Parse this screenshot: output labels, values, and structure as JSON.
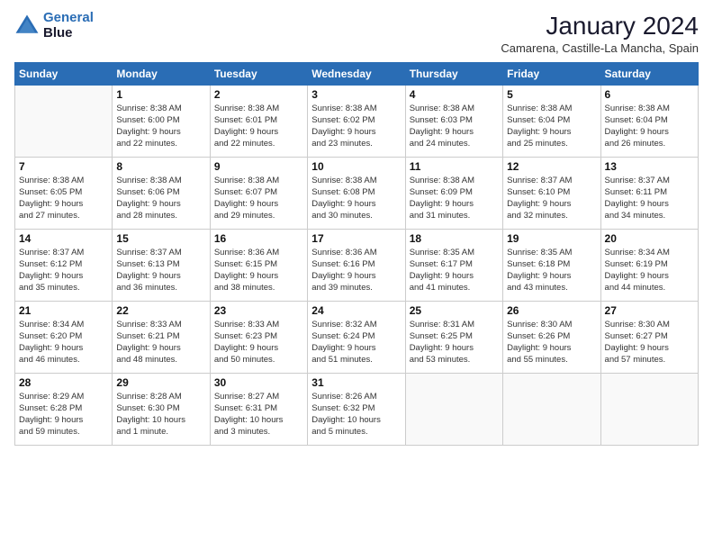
{
  "logo": {
    "line1": "General",
    "line2": "Blue"
  },
  "title": "January 2024",
  "subtitle": "Camarena, Castille-La Mancha, Spain",
  "days_of_week": [
    "Sunday",
    "Monday",
    "Tuesday",
    "Wednesday",
    "Thursday",
    "Friday",
    "Saturday"
  ],
  "weeks": [
    [
      {
        "day": "",
        "info": ""
      },
      {
        "day": "1",
        "info": "Sunrise: 8:38 AM\nSunset: 6:00 PM\nDaylight: 9 hours\nand 22 minutes."
      },
      {
        "day": "2",
        "info": "Sunrise: 8:38 AM\nSunset: 6:01 PM\nDaylight: 9 hours\nand 22 minutes."
      },
      {
        "day": "3",
        "info": "Sunrise: 8:38 AM\nSunset: 6:02 PM\nDaylight: 9 hours\nand 23 minutes."
      },
      {
        "day": "4",
        "info": "Sunrise: 8:38 AM\nSunset: 6:03 PM\nDaylight: 9 hours\nand 24 minutes."
      },
      {
        "day": "5",
        "info": "Sunrise: 8:38 AM\nSunset: 6:04 PM\nDaylight: 9 hours\nand 25 minutes."
      },
      {
        "day": "6",
        "info": "Sunrise: 8:38 AM\nSunset: 6:04 PM\nDaylight: 9 hours\nand 26 minutes."
      }
    ],
    [
      {
        "day": "7",
        "info": "Sunrise: 8:38 AM\nSunset: 6:05 PM\nDaylight: 9 hours\nand 27 minutes."
      },
      {
        "day": "8",
        "info": "Sunrise: 8:38 AM\nSunset: 6:06 PM\nDaylight: 9 hours\nand 28 minutes."
      },
      {
        "day": "9",
        "info": "Sunrise: 8:38 AM\nSunset: 6:07 PM\nDaylight: 9 hours\nand 29 minutes."
      },
      {
        "day": "10",
        "info": "Sunrise: 8:38 AM\nSunset: 6:08 PM\nDaylight: 9 hours\nand 30 minutes."
      },
      {
        "day": "11",
        "info": "Sunrise: 8:38 AM\nSunset: 6:09 PM\nDaylight: 9 hours\nand 31 minutes."
      },
      {
        "day": "12",
        "info": "Sunrise: 8:37 AM\nSunset: 6:10 PM\nDaylight: 9 hours\nand 32 minutes."
      },
      {
        "day": "13",
        "info": "Sunrise: 8:37 AM\nSunset: 6:11 PM\nDaylight: 9 hours\nand 34 minutes."
      }
    ],
    [
      {
        "day": "14",
        "info": "Sunrise: 8:37 AM\nSunset: 6:12 PM\nDaylight: 9 hours\nand 35 minutes."
      },
      {
        "day": "15",
        "info": "Sunrise: 8:37 AM\nSunset: 6:13 PM\nDaylight: 9 hours\nand 36 minutes."
      },
      {
        "day": "16",
        "info": "Sunrise: 8:36 AM\nSunset: 6:15 PM\nDaylight: 9 hours\nand 38 minutes."
      },
      {
        "day": "17",
        "info": "Sunrise: 8:36 AM\nSunset: 6:16 PM\nDaylight: 9 hours\nand 39 minutes."
      },
      {
        "day": "18",
        "info": "Sunrise: 8:35 AM\nSunset: 6:17 PM\nDaylight: 9 hours\nand 41 minutes."
      },
      {
        "day": "19",
        "info": "Sunrise: 8:35 AM\nSunset: 6:18 PM\nDaylight: 9 hours\nand 43 minutes."
      },
      {
        "day": "20",
        "info": "Sunrise: 8:34 AM\nSunset: 6:19 PM\nDaylight: 9 hours\nand 44 minutes."
      }
    ],
    [
      {
        "day": "21",
        "info": "Sunrise: 8:34 AM\nSunset: 6:20 PM\nDaylight: 9 hours\nand 46 minutes."
      },
      {
        "day": "22",
        "info": "Sunrise: 8:33 AM\nSunset: 6:21 PM\nDaylight: 9 hours\nand 48 minutes."
      },
      {
        "day": "23",
        "info": "Sunrise: 8:33 AM\nSunset: 6:23 PM\nDaylight: 9 hours\nand 50 minutes."
      },
      {
        "day": "24",
        "info": "Sunrise: 8:32 AM\nSunset: 6:24 PM\nDaylight: 9 hours\nand 51 minutes."
      },
      {
        "day": "25",
        "info": "Sunrise: 8:31 AM\nSunset: 6:25 PM\nDaylight: 9 hours\nand 53 minutes."
      },
      {
        "day": "26",
        "info": "Sunrise: 8:30 AM\nSunset: 6:26 PM\nDaylight: 9 hours\nand 55 minutes."
      },
      {
        "day": "27",
        "info": "Sunrise: 8:30 AM\nSunset: 6:27 PM\nDaylight: 9 hours\nand 57 minutes."
      }
    ],
    [
      {
        "day": "28",
        "info": "Sunrise: 8:29 AM\nSunset: 6:28 PM\nDaylight: 9 hours\nand 59 minutes."
      },
      {
        "day": "29",
        "info": "Sunrise: 8:28 AM\nSunset: 6:30 PM\nDaylight: 10 hours\nand 1 minute."
      },
      {
        "day": "30",
        "info": "Sunrise: 8:27 AM\nSunset: 6:31 PM\nDaylight: 10 hours\nand 3 minutes."
      },
      {
        "day": "31",
        "info": "Sunrise: 8:26 AM\nSunset: 6:32 PM\nDaylight: 10 hours\nand 5 minutes."
      },
      {
        "day": "",
        "info": ""
      },
      {
        "day": "",
        "info": ""
      },
      {
        "day": "",
        "info": ""
      }
    ]
  ]
}
